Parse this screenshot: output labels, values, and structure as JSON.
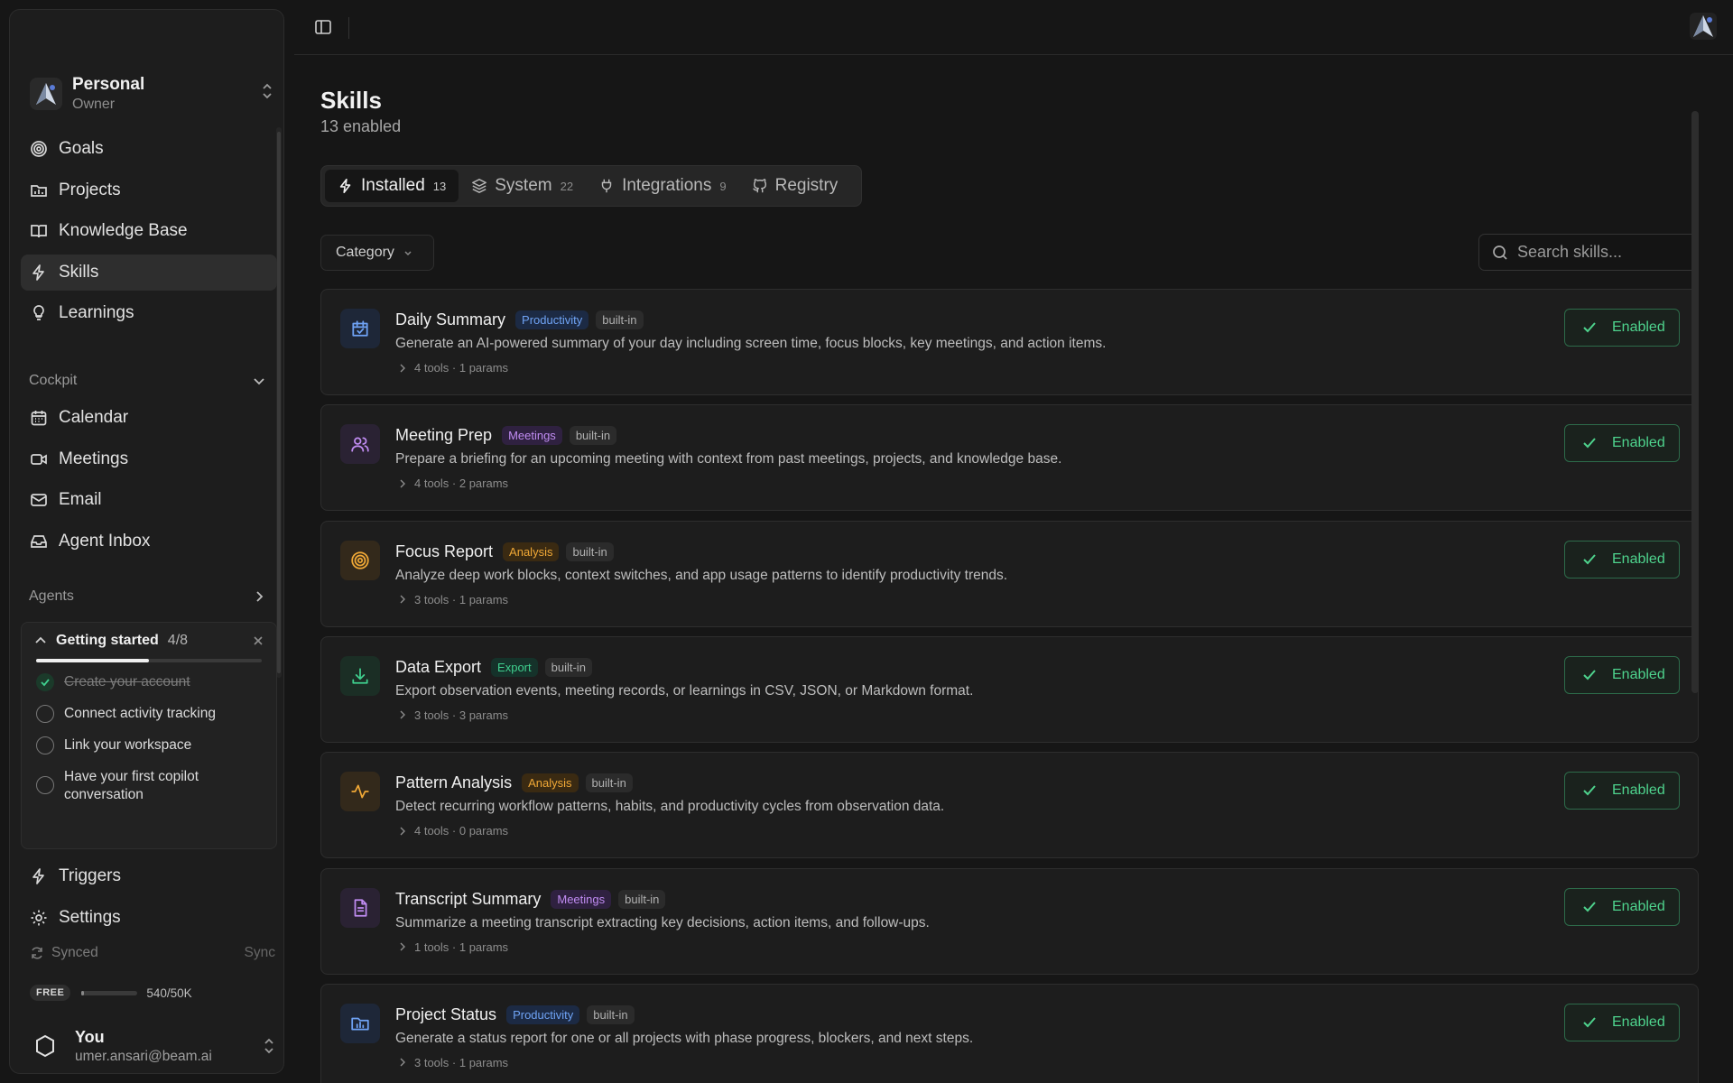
{
  "workspace": {
    "name": "Personal",
    "role": "Owner"
  },
  "nav_primary": [
    {
      "label": "Goals",
      "icon": "target-icon"
    },
    {
      "label": "Projects",
      "icon": "folder-icon"
    },
    {
      "label": "Knowledge Base",
      "icon": "book-icon"
    },
    {
      "label": "Skills",
      "icon": "lightning-icon",
      "active": true
    },
    {
      "label": "Learnings",
      "icon": "lightbulb-icon"
    }
  ],
  "cockpit": {
    "label": "Cockpit",
    "items": [
      {
        "label": "Calendar",
        "icon": "calendar-icon"
      },
      {
        "label": "Meetings",
        "icon": "video-icon"
      },
      {
        "label": "Email",
        "icon": "mail-icon"
      },
      {
        "label": "Agent Inbox",
        "icon": "inbox-icon"
      }
    ]
  },
  "agents": {
    "label": "Agents"
  },
  "getting_started": {
    "title": "Getting started",
    "count": "4/8",
    "progress": 0.5,
    "items": [
      {
        "label": "Create your account",
        "done": true
      },
      {
        "label": "Connect activity tracking",
        "done": false
      },
      {
        "label": "Link your workspace",
        "done": false
      },
      {
        "label": "Have your first copilot conversation",
        "done": false
      }
    ]
  },
  "nav_bottom": [
    {
      "label": "Triggers",
      "icon": "lightning-icon"
    },
    {
      "label": "Settings",
      "icon": "gear-icon"
    }
  ],
  "sync": {
    "status": "Synced",
    "action": "Sync"
  },
  "plan": {
    "badge": "FREE",
    "usage": "540/50K",
    "fraction": 0.0108
  },
  "user": {
    "name": "You",
    "email": "umer.ansari@beam.ai"
  },
  "page": {
    "title": "Skills",
    "subtitle": "13 enabled"
  },
  "tabs": [
    {
      "label": "Installed",
      "count": "13",
      "icon": "lightning-icon",
      "active": true
    },
    {
      "label": "System",
      "count": "22",
      "icon": "layers-icon"
    },
    {
      "label": "Integrations",
      "count": "9",
      "icon": "plug-icon"
    },
    {
      "label": "Registry",
      "count": "",
      "icon": "github-icon"
    }
  ],
  "filters": {
    "category": "Category",
    "search_placeholder": "Search skills..."
  },
  "enabled_label": "Enabled",
  "builtin_label": "built-in",
  "tag_colors": {
    "Productivity": {
      "bg": "#1c2a44",
      "fg": "#6fa3f5"
    },
    "Meetings": {
      "bg": "#2f2140",
      "fg": "#c08cf2"
    },
    "Analysis": {
      "bg": "#3a2a12",
      "fg": "#f0a836"
    },
    "Export": {
      "bg": "#15322a",
      "fg": "#3fcf8e"
    }
  },
  "skills": [
    {
      "name": "Daily Summary",
      "category": "Productivity",
      "icon": "calendar-check-icon",
      "icon_color": "#6fa3f5",
      "icon_bg": "#1e2738",
      "description": "Generate an AI-powered summary of your day including screen time, focus blocks, key meetings, and action items.",
      "meta": "4 tools · 1 params"
    },
    {
      "name": "Meeting Prep",
      "category": "Meetings",
      "icon": "users-icon",
      "icon_color": "#c08cf2",
      "icon_bg": "#2a2233",
      "description": "Prepare a briefing for an upcoming meeting with context from past meetings, projects, and knowledge base.",
      "meta": "4 tools · 2 params"
    },
    {
      "name": "Focus Report",
      "category": "Analysis",
      "icon": "target-icon",
      "icon_color": "#f0a836",
      "icon_bg": "#33291b",
      "description": "Analyze deep work blocks, context switches, and app usage patterns to identify productivity trends.",
      "meta": "3 tools · 1 params"
    },
    {
      "name": "Data Export",
      "category": "Export",
      "icon": "download-icon",
      "icon_color": "#3fcf8e",
      "icon_bg": "#1b2e25",
      "description": "Export observation events, meeting records, or learnings in CSV, JSON, or Markdown format.",
      "meta": "3 tools · 3 params"
    },
    {
      "name": "Pattern Analysis",
      "category": "Analysis",
      "icon": "activity-icon",
      "icon_color": "#f0a836",
      "icon_bg": "#33291b",
      "description": "Detect recurring workflow patterns, habits, and productivity cycles from observation data.",
      "meta": "4 tools · 0 params"
    },
    {
      "name": "Transcript Summary",
      "category": "Meetings",
      "icon": "file-text-icon",
      "icon_color": "#c08cf2",
      "icon_bg": "#2a2233",
      "description": "Summarize a meeting transcript extracting key decisions, action items, and follow-ups.",
      "meta": "1 tools · 1 params"
    },
    {
      "name": "Project Status",
      "category": "Productivity",
      "icon": "folder-chart-icon",
      "icon_color": "#6fa3f5",
      "icon_bg": "#1e2738",
      "description": "Generate a status report for one or all projects with phase progress, blockers, and next steps.",
      "meta": "3 tools · 1 params"
    }
  ]
}
